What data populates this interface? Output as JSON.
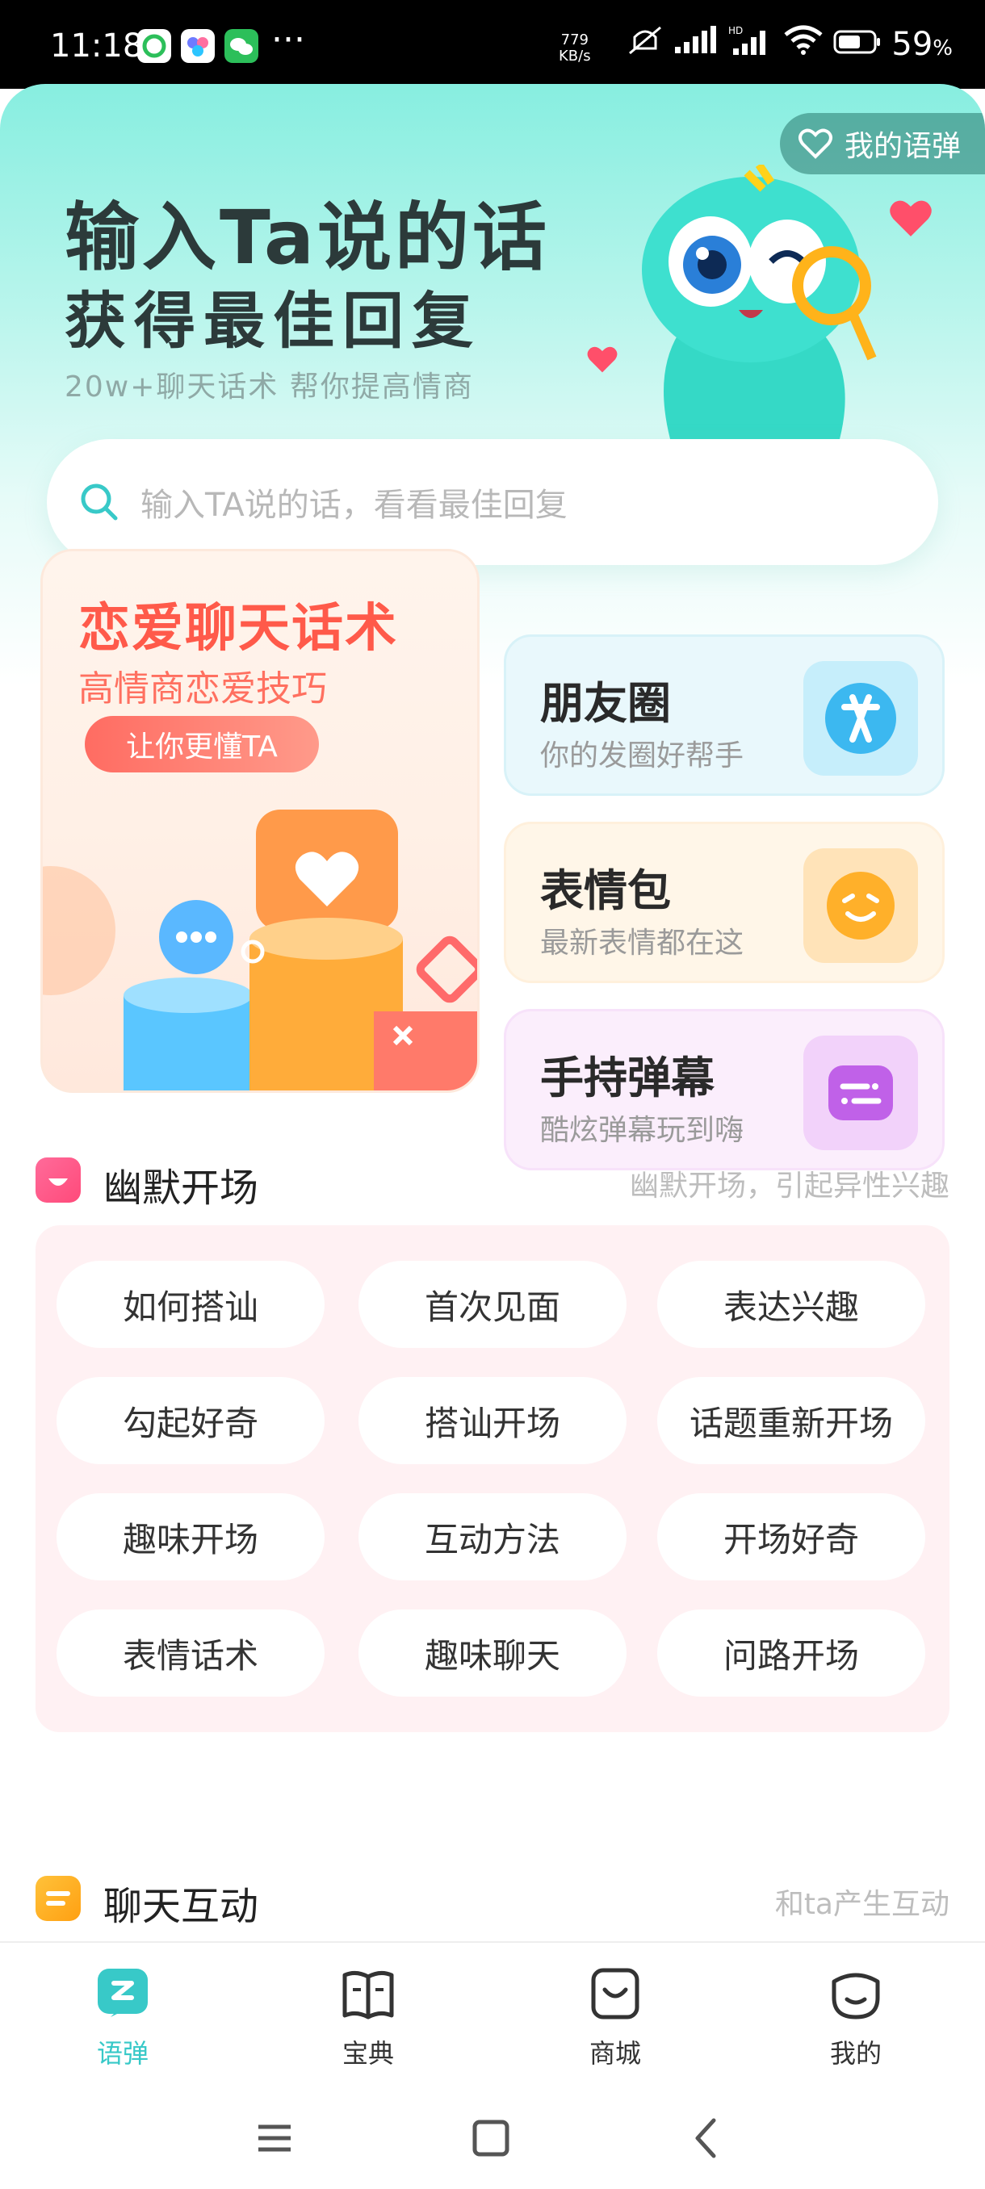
{
  "status_bar": {
    "time": "11:18",
    "more": "···",
    "speed_value": "779",
    "speed_unit": "KB/s",
    "battery": "59",
    "battery_unit": "%"
  },
  "header": {
    "my_words": "我的语弹",
    "title_line1": "输入Ta说的话",
    "title_line2": "获得最佳回复",
    "subtitle": "20w+聊天话术 帮你提高情商"
  },
  "search": {
    "placeholder": "输入TA说的话，看看最佳回复"
  },
  "features": {
    "big": {
      "title": "恋爱聊天话术",
      "subtitle": "高情商恋爱技巧",
      "pill": "让你更懂TA"
    },
    "cards": [
      {
        "title": "朋友圈",
        "subtitle": "你的发圈好帮手",
        "icon": "friends-circle-icon"
      },
      {
        "title": "表情包",
        "subtitle": "最新表情都在这",
        "icon": "emoji-icon"
      },
      {
        "title": "手持弹幕",
        "subtitle": "酷炫弹幕玩到嗨",
        "icon": "danmaku-icon"
      }
    ]
  },
  "section_humor": {
    "title": "幽默开场",
    "desc": "幽默开场，引起异性兴趣",
    "chips": [
      "如何搭讪",
      "首次见面",
      "表达兴趣",
      "勾起好奇",
      "搭讪开场",
      "话题重新开场",
      "趣味开场",
      "互动方法",
      "开场好奇",
      "表情话术",
      "趣味聊天",
      "问路开场"
    ]
  },
  "section_chat": {
    "title": "聊天互动",
    "desc": "和ta产生互动"
  },
  "tabs": [
    {
      "label": "语弹",
      "icon": "chat-bubble-icon",
      "active": true
    },
    {
      "label": "宝典",
      "icon": "book-icon",
      "active": false
    },
    {
      "label": "商城",
      "icon": "shop-bag-icon",
      "active": false
    },
    {
      "label": "我的",
      "icon": "profile-face-icon",
      "active": false
    }
  ],
  "colors": {
    "accent": "#38c9c8",
    "love_red": "#ff5a4a",
    "chip_bg": "#fff1f3"
  }
}
